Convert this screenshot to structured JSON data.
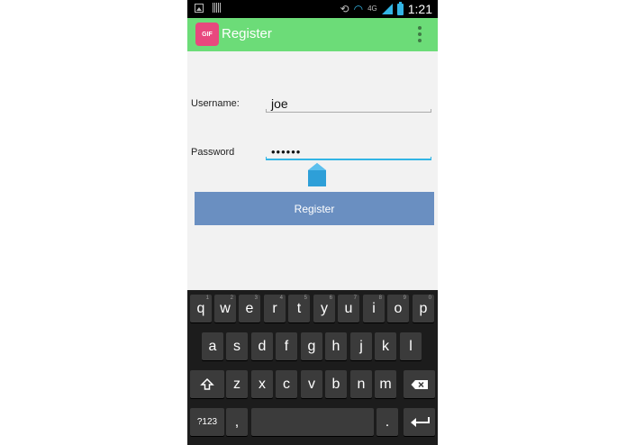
{
  "status_bar": {
    "time": "1:21",
    "network": "4G"
  },
  "action_bar": {
    "title": "Register",
    "icon_text": "GIF"
  },
  "form": {
    "username_label": "Username:",
    "username_value": "joe",
    "password_label": "Password",
    "password_value": "••••••"
  },
  "register_button": "Register",
  "keyboard": {
    "row1": [
      "q",
      "w",
      "e",
      "r",
      "t",
      "y",
      "u",
      "i",
      "o",
      "p"
    ],
    "row1_hints": [
      "1",
      "2",
      "3",
      "4",
      "5",
      "6",
      "7",
      "8",
      "9",
      "0"
    ],
    "row2": [
      "a",
      "s",
      "d",
      "f",
      "g",
      "h",
      "j",
      "k",
      "l"
    ],
    "row3": [
      "z",
      "x",
      "c",
      "v",
      "b",
      "n",
      "m"
    ],
    "symbols_key": "?123",
    "comma_key": ",",
    "period_key": "."
  }
}
